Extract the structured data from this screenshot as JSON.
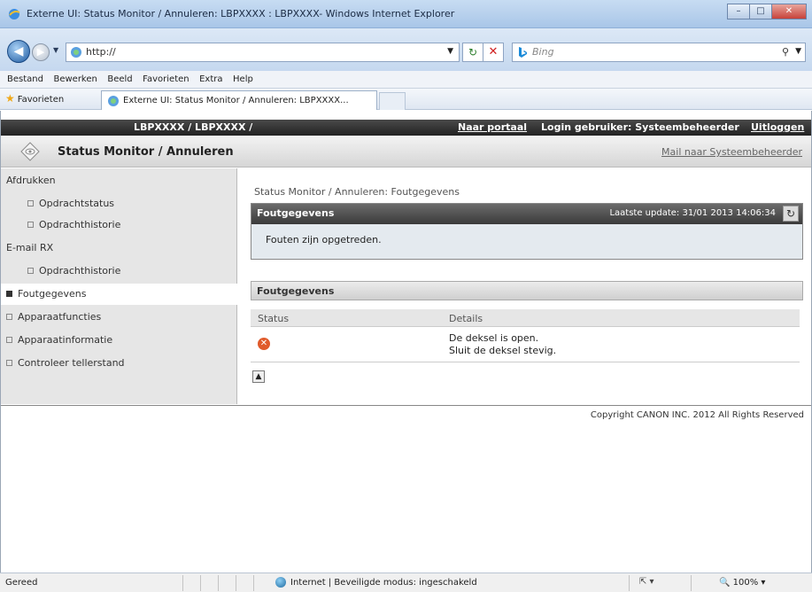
{
  "window": {
    "title": "Externe UI: Status Monitor / Annuleren: LBPXXXX : LBPXXXX- Windows Internet Explorer",
    "min": "–",
    "max": "□",
    "close": "✕"
  },
  "address": {
    "url": "http://",
    "search_placeholder": "Bing"
  },
  "menu": [
    "Bestand",
    "Bewerken",
    "Beeld",
    "Favorieten",
    "Extra",
    "Help"
  ],
  "favorites": {
    "label": "Favorieten",
    "tab_label": "Externe UI: Status Monitor / Annuleren: LBPXXXX..."
  },
  "header": {
    "device": "LBPXXXX / LBPXXXX /",
    "portal": "Naar portaal",
    "login": "Login gebruiker: Systeembeheerder",
    "logout": "Uitloggen",
    "page_title": "Status Monitor / Annuleren",
    "mail": "Mail naar Systeembeheerder"
  },
  "sidebar": {
    "items": [
      {
        "label": "Afdrukken"
      },
      {
        "label": "Opdrachtstatus"
      },
      {
        "label": "Opdrachthistorie"
      },
      {
        "label": "E-mail RX"
      },
      {
        "label": "Opdrachthistorie"
      },
      {
        "label": "Foutgegevens"
      },
      {
        "label": "Apparaatfuncties"
      },
      {
        "label": "Apparaatinformatie"
      },
      {
        "label": "Controleer tellerstand"
      }
    ]
  },
  "main": {
    "breadcrumb": "Status Monitor / Annuleren: Foutgegevens",
    "panel1_title": "Foutgegevens",
    "last_update": "Laatste update: 31/01 2013 14:06:34",
    "message": "Fouten zijn opgetreden.",
    "panel2_title": "Foutgegevens",
    "table": {
      "col_status": "Status",
      "col_details": "Details",
      "rows": [
        {
          "detail1": "De deksel is open.",
          "detail2": "Sluit de deksel stevig."
        }
      ]
    },
    "copyright": "Copyright CANON INC. 2012 All Rights Reserved"
  },
  "statusbar": {
    "status": "Gereed",
    "zone": "Internet | Beveiligde modus: ingeschakeld",
    "zoom": "100%"
  }
}
